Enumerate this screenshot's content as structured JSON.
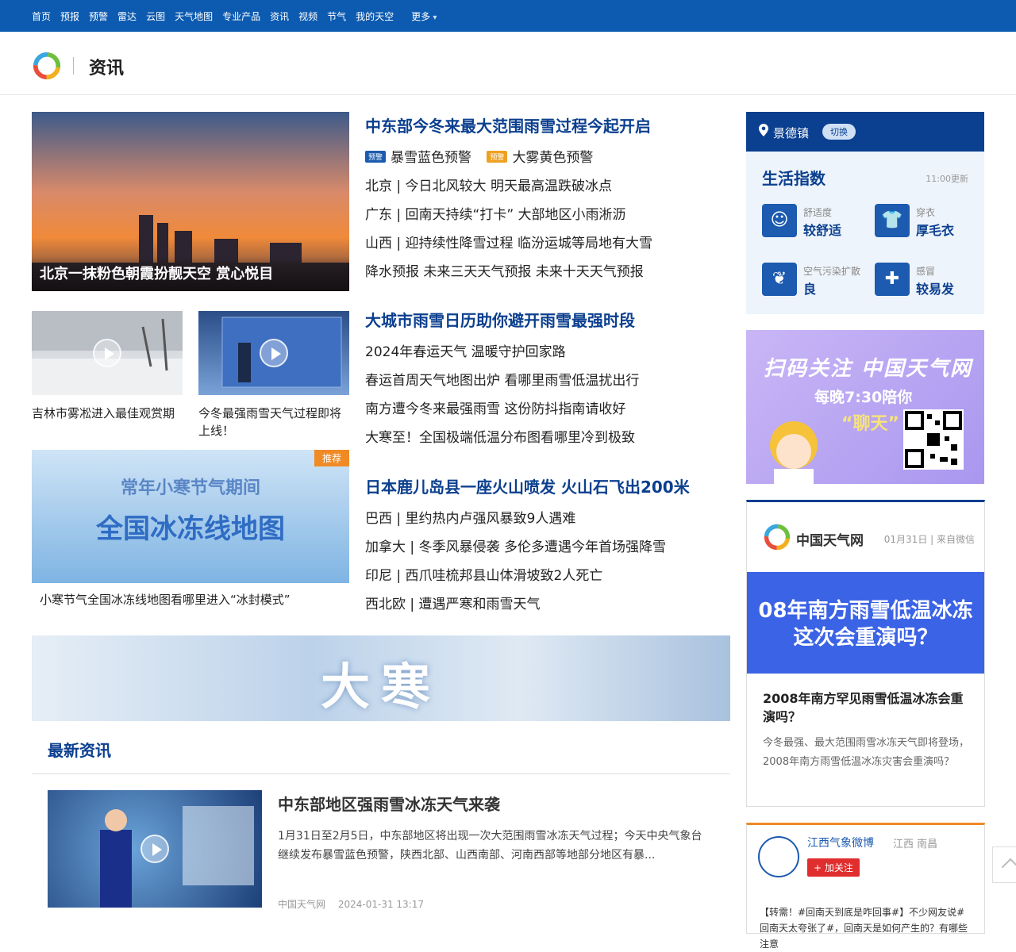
{
  "nav": {
    "items": [
      "首页",
      "预报",
      "预警",
      "雷达",
      "云图",
      "天气地图",
      "专业产品",
      "资讯",
      "视频",
      "节气",
      "我的天空"
    ],
    "more": "更多"
  },
  "header": {
    "title": "资讯"
  },
  "headline": {
    "image_caption": "北京一抹粉色朝霞扮靓天空 赏心悦目",
    "block1": {
      "title": "中东部今冬来最大范围雨雪过程今起开启",
      "warnings": [
        {
          "badge": "预警",
          "text": "暴雪蓝色预警",
          "color": "#1c5baf"
        },
        {
          "badge": "预警",
          "text": "大雾黄色预警",
          "color": "#f0a020"
        }
      ],
      "lines": [
        "北京 | 今日北风较大 明天最高温跌破冰点",
        "广东 | 回南天持续“打卡” 大部地区小雨淅沥",
        "山西 | 迎持续性降雪过程 临汾运城等局地有大雪"
      ],
      "links": [
        "降水预报",
        "未来三天天气预报",
        "未来十天天气预报"
      ]
    },
    "block2": {
      "title": "大城市雨雪日历助你避开雨雪最强时段",
      "lines": [
        "2024年春运天气 温暖守护回家路",
        "春运首周天气地图出炉 看哪里雨雪低温扰出行",
        "南方遭今冬来最强雨雪 这份防抖指南请收好",
        "大寒至！全国极端低温分布图看哪里冷到极致"
      ]
    },
    "block3": {
      "title": "日本鹿儿岛县一座火山喷发 火山石飞出200米",
      "lines": [
        "巴西 | 里约热内卢强风暴致9人遇难",
        "加拿大 | 冬季风暴侵袭 多伦多遭遇今年首场强降雪",
        "印尼 | 西爪哇梳邦县山体滑坡致2人死亡",
        "西北欧 | 遭遇严寒和雨雪天气"
      ]
    },
    "video1_caption": "吉林市雾凇进入最佳观赏期",
    "video2_caption": "今冬最强雨雪天气过程即将上线！",
    "feature_tag": "推荐",
    "feature_line1": "常年小寒节气期间",
    "feature_line2": "全国冰冻线地图",
    "feature_caption": "小寒节气全国冰冻线地图看哪里进入“冰封模式”",
    "banner_text": "大寒"
  },
  "latest": {
    "section_title": "最新资讯",
    "article": {
      "title": "中东部地区强雨雪冰冻天气来袭",
      "summary": "1月31日至2月5日，中东部地区将出现一次大范围雨雪冰冻天气过程；今天中央气象台继续发布暴雪蓝色预警，陕西北部、山西南部、河南西部等地部分地区有暴...",
      "source": "中国天气网",
      "time": "2024-01-31 13:17"
    }
  },
  "sidebar": {
    "city": "景德镇",
    "switch": "切换",
    "life": {
      "title": "生活指数",
      "updated": "11:00更新",
      "items": [
        {
          "name": "舒适度",
          "value": "较舒适",
          "icon": "smile-icon",
          "glyph": "☺"
        },
        {
          "name": "穿衣",
          "value": "厚毛衣",
          "icon": "shirt-icon",
          "glyph": "👕"
        },
        {
          "name": "空气污染扩散",
          "value": "良",
          "icon": "leaf-icon",
          "glyph": "❦"
        },
        {
          "name": "感冒",
          "value": "较易发",
          "icon": "pill-icon",
          "glyph": "✚"
        }
      ]
    },
    "ad": {
      "line1": "扫码关注 中国天气网",
      "line2": "每晚7:30陪你",
      "line3": "“聊天”"
    },
    "card": {
      "brand": "中国天气网",
      "meta": "01月31日 | 来自微信",
      "pic_line1": "08年南方雨雪低温冰冻",
      "pic_line2": "这次会重演吗？",
      "title": "2008年南方罕见雨雪低温冰冻会重演吗？",
      "text": "今冬最强、最大范围雨雪冰冻天气即将登场，2008年南方雨雪低温冰冻灾害会重演吗？"
    },
    "weibo": {
      "name": "江西气象微博",
      "location": "江西 南昌",
      "follow": "+ 加关注",
      "post": "【转需！#回南天到底是咋回事#】不少网友说#回南天太夸张了#，回南天是如何产生的？有哪些注意"
    }
  }
}
